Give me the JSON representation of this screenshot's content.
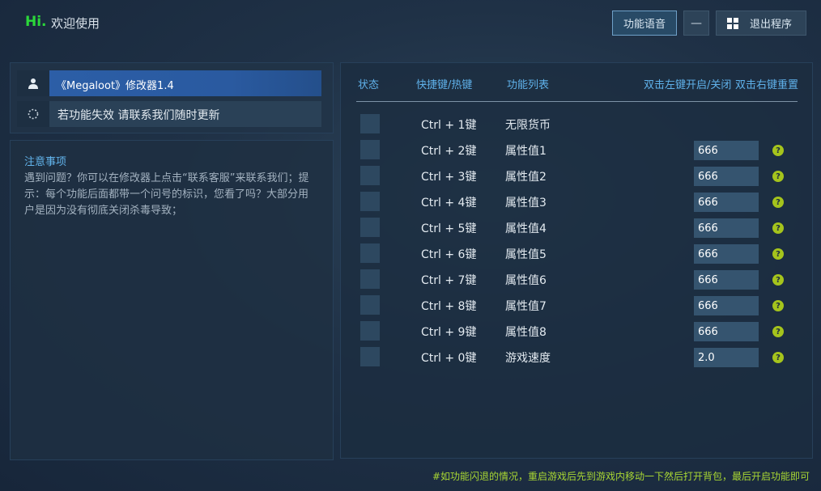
{
  "header": {
    "hi": "Hi.",
    "welcome": "欢迎使用",
    "voice_button": "功能语音",
    "minimize_button": "—",
    "exit_button": "退出程序"
  },
  "info_panel": {
    "title": "《Megaloot》修改器1.4",
    "warning": "若功能失效 请联系我们随时更新"
  },
  "notes": {
    "title": "注意事项",
    "body": "遇到问题？你可以在修改器上点击“联系客服”来联系我们；提示：每个功能后面都带一个问号的标识，您看了吗？大部分用户是因为没有彻底关闭杀毒导致；"
  },
  "table": {
    "col_status": "状态",
    "col_hotkey": "快捷键/热键",
    "col_function": "功能列表",
    "hint_left": "双击左键开启/关闭",
    "hint_right": "双击右键重置",
    "rows": [
      {
        "hotkey": "Ctrl + 1键",
        "name": "无限货币",
        "value": null
      },
      {
        "hotkey": "Ctrl + 2键",
        "name": "属性值1",
        "value": "666"
      },
      {
        "hotkey": "Ctrl + 3键",
        "name": "属性值2",
        "value": "666"
      },
      {
        "hotkey": "Ctrl + 4键",
        "name": "属性值3",
        "value": "666"
      },
      {
        "hotkey": "Ctrl + 5键",
        "name": "属性值4",
        "value": "666"
      },
      {
        "hotkey": "Ctrl + 6键",
        "name": "属性值5",
        "value": "666"
      },
      {
        "hotkey": "Ctrl + 7键",
        "name": "属性值6",
        "value": "666"
      },
      {
        "hotkey": "Ctrl + 8键",
        "name": "属性值7",
        "value": "666"
      },
      {
        "hotkey": "Ctrl + 9键",
        "name": "属性值8",
        "value": "666"
      },
      {
        "hotkey": "Ctrl + 0键",
        "name": "游戏速度",
        "value": "2.0"
      }
    ],
    "help_glyph": "?"
  },
  "footer": "#如功能闪退的情况，重启游戏后先到游戏内移动一下然后打开背包，最后开启功能即可",
  "colors": {
    "accent": "#5fb1ea",
    "hi": "#2bd83a",
    "footer": "#a8d633",
    "selected_row": "#2c5fa8"
  }
}
